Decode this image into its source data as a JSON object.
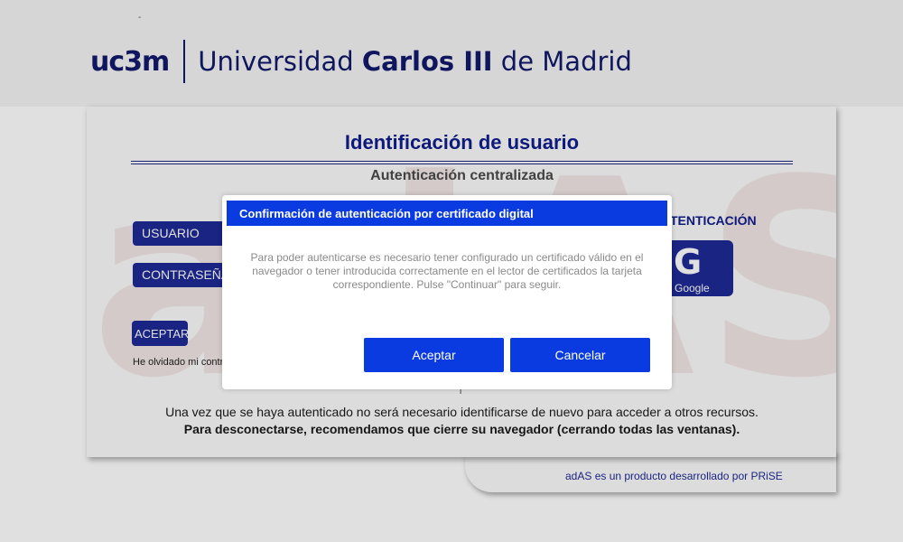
{
  "header": {
    "dash": "-",
    "logo_mark": "uc3m",
    "logo_name_prefix": "Universidad ",
    "logo_name_bold": "Carlos III",
    "logo_name_suffix": " de Madrid"
  },
  "login": {
    "watermark": "adAS",
    "title": "Identificación de usuario",
    "subtitle": "Autenticación centralizada",
    "user_label": "USUARIO",
    "password_label": "CONTRASEÑA",
    "accept_label": "ACEPTAR",
    "forgot_link": "He olvidado mi contraseña",
    "external_title": "TENTICACIÓN",
    "google_label": "Google",
    "info_line1": "Una vez que se haya autenticado no será necesario identificarse de nuevo para acceder a otros recursos.",
    "info_line2": "Para desconectarse, recomendamos que cierre su navegador (cerrando todas las ventanas).",
    "footer": "adAS es un producto desarrollado por PRiSE",
    "small_mark": "i"
  },
  "modal": {
    "title": "Confirmación de autenticación por certificado digital",
    "message": "Para poder autenticarse es necesario tener configurado un certificado válido en el navegador o tener introducida correctamente en el lector de certificados la tarjeta correspondiente. Pulse \"Continuar\" para seguir.",
    "ok_label": "Aceptar",
    "cancel_label": "Cancelar"
  },
  "colors": {
    "brand_navy": "#121a6b",
    "button_navy": "#1e2a96",
    "modal_blue": "#0a3be0"
  }
}
